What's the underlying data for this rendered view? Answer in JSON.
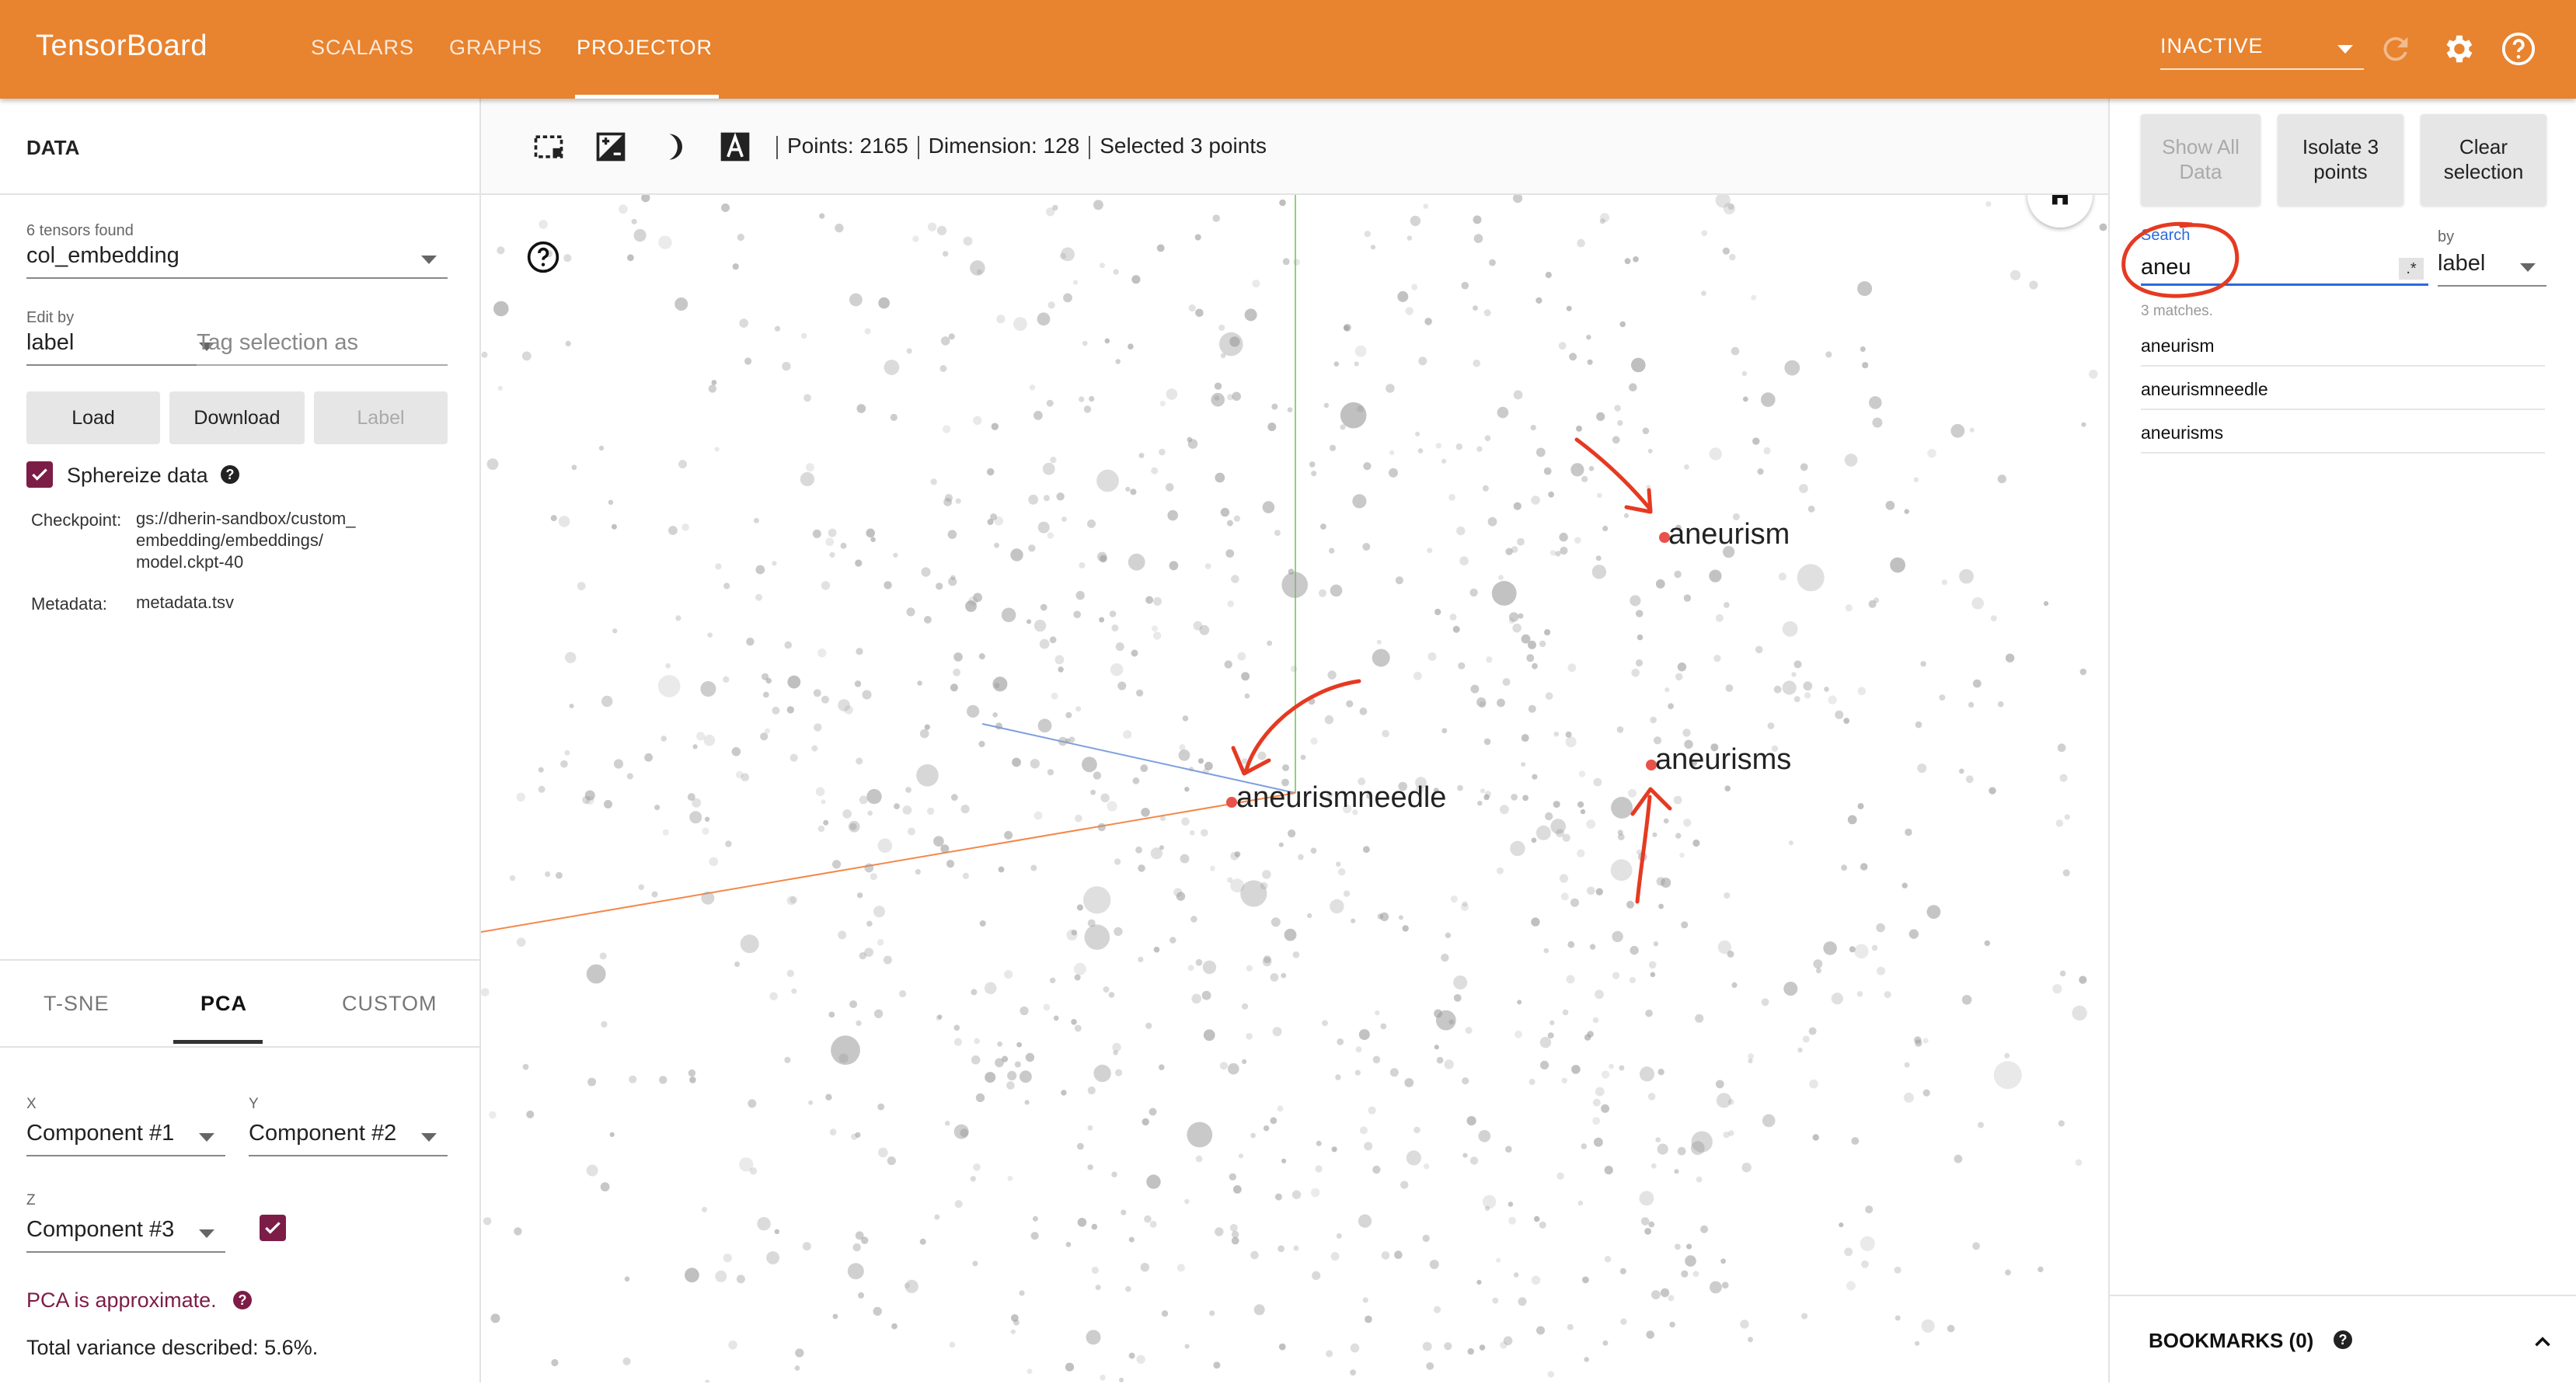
{
  "header": {
    "brand": "TensorBoard",
    "tabs": [
      {
        "label": "SCALARS"
      },
      {
        "label": "GRAPHS"
      },
      {
        "label": "PROJECTOR"
      }
    ],
    "run_select": "INACTIVE",
    "icons": [
      "refresh-icon",
      "settings-icon",
      "help-icon"
    ]
  },
  "left_panel": {
    "title": "DATA",
    "tensors_found": "6 tensors found",
    "tensor_value": "col_embedding",
    "edit_by_label": "Edit by",
    "edit_by_value": "label",
    "tag_placeholder": "Tag selection as",
    "buttons": {
      "load": "Load",
      "download": "Download",
      "label": "Label"
    },
    "spherize_label": "Sphereize data",
    "checkpoint_key": "Checkpoint:",
    "checkpoint_lines": [
      "gs://dherin-sandbox/custom_",
      "embedding/embeddings/",
      "model.ckpt-40"
    ],
    "metadata_key": "Metadata:",
    "metadata_value": "metadata.tsv",
    "projection_tabs": [
      "T-SNE",
      "PCA",
      "CUSTOM"
    ],
    "x_label": "X",
    "x_value": "Component #1",
    "y_label": "Y",
    "y_value": "Component #2",
    "z_label": "Z",
    "z_value": "Component #3",
    "pca_note": "PCA is approximate.",
    "variance": "Total variance described: 5.6%."
  },
  "toolbar": {
    "icons": [
      "bounding-box-select-icon",
      "night-mode-icon",
      "contrast-icon",
      "label-toggle-icon"
    ],
    "points": "Points: 2165",
    "dimension": "Dimension: 128",
    "selected": "Selected 3 points"
  },
  "canvas": {
    "labels": {
      "aneurism": "aneurism",
      "aneurisms": "aneurisms",
      "aneurismneedle": "aneurismneedle"
    },
    "colors": {
      "point": "#9c9c9c",
      "highlight": "#e8524a",
      "annotation": "#e53a22",
      "x_axis": "#f5874a",
      "y_axis": "#8fd17a",
      "z_axis": "#7f9fe0"
    }
  },
  "right_panel": {
    "buttons": {
      "show_all": [
        "Show All",
        "Data"
      ],
      "isolate": [
        "Isolate 3",
        "points"
      ],
      "clear": [
        "Clear",
        "selection"
      ]
    },
    "search_label": "Search",
    "search_value": "aneu",
    "regex_symbol": ".*",
    "by_label": "by",
    "by_value": "label",
    "matches_count": "3 matches.",
    "matches": [
      "aneurism",
      "aneurismneedle",
      "aneurisms"
    ],
    "bookmarks": "BOOKMARKS (0)"
  },
  "accent_colors": {
    "header": "#e8832f",
    "checkbox": "#7c1d47",
    "search": "#2a6ad9"
  }
}
